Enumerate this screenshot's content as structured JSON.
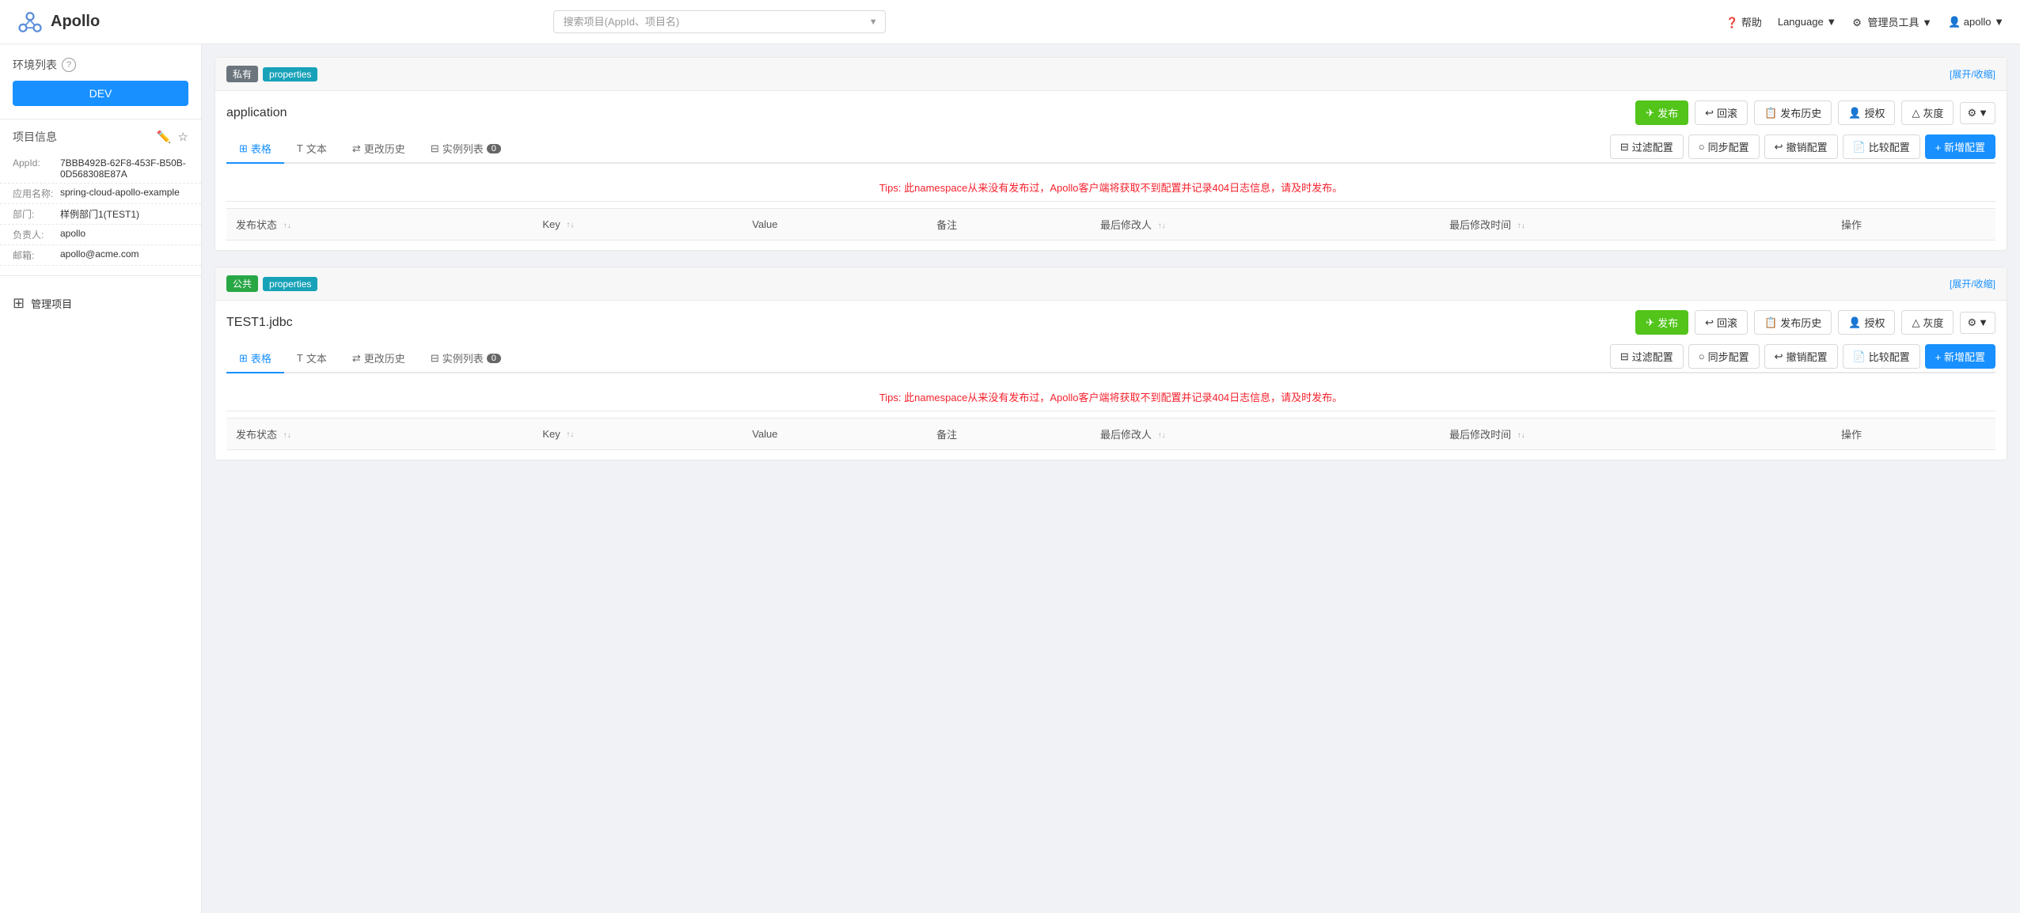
{
  "header": {
    "logo_text": "Apollo",
    "search_placeholder": "搜索项目(AppId、项目名)",
    "help_label": "帮助",
    "language_label": "Language",
    "admin_tools_label": "管理员工具",
    "user_label": "apollo"
  },
  "sidebar": {
    "env_list_label": "环境列表",
    "env_dev_label": "DEV",
    "project_info_label": "项目信息",
    "appid_label": "AppId:",
    "appid_value": "7BBB492B-62F8-453F-B50B-0D568308E87A",
    "app_name_label": "应用名称:",
    "app_name_value": "spring-cloud-apollo-example",
    "dept_label": "部门:",
    "dept_value": "样例部门1(TEST1)",
    "owner_label": "负责人:",
    "owner_value": "apollo",
    "email_label": "邮箱:",
    "email_value": "apollo@acme.com",
    "manage_project_label": "管理项目"
  },
  "namespaces": [
    {
      "id": "ns1",
      "badge_type": "private",
      "badge_label": "私有",
      "type_label": "properties",
      "expand_label": "[展开/收缩]",
      "title": "application",
      "publish_btn": "发布",
      "rollback_btn": "回滚",
      "history_btn": "发布历史",
      "auth_btn": "授权",
      "gray_btn": "灰度",
      "tab_table": "表格",
      "tab_text": "文本",
      "tab_history": "更改历史",
      "tab_instances": "实例列表",
      "instance_count": "0",
      "filter_btn": "过滤配置",
      "sync_btn": "同步配置",
      "cancel_btn": "撤销配置",
      "compare_btn": "比较配置",
      "add_btn": "+ 新增配置",
      "tips": "Tips: 此namespace从来没有发布过，Apollo客户端将获取不到配置并记录404日志信息，请及时发布。",
      "col_status": "发布状态",
      "col_key": "Key",
      "col_value": "Value",
      "col_note": "备注",
      "col_modifier": "最后修改人",
      "col_time": "最后修改时间",
      "col_action": "操作"
    },
    {
      "id": "ns2",
      "badge_type": "public",
      "badge_label": "公共",
      "type_label": "properties",
      "expand_label": "[展开/收缩]",
      "title": "TEST1.jdbc",
      "publish_btn": "发布",
      "rollback_btn": "回滚",
      "history_btn": "发布历史",
      "auth_btn": "授权",
      "gray_btn": "灰度",
      "tab_table": "表格",
      "tab_text": "文本",
      "tab_history": "更改历史",
      "tab_instances": "实例列表",
      "instance_count": "0",
      "filter_btn": "过滤配置",
      "sync_btn": "同步配置",
      "cancel_btn": "撤销配置",
      "compare_btn": "比较配置",
      "add_btn": "+ 新增配置",
      "tips": "Tips: 此namespace从来没有发布过，Apollo客户端将获取不到配置并记录404日志信息，请及时发布。",
      "col_status": "发布状态",
      "col_key": "Key",
      "col_value": "Value",
      "col_note": "备注",
      "col_modifier": "最后修改人",
      "col_time": "最后修改时间",
      "col_action": "操作"
    }
  ]
}
